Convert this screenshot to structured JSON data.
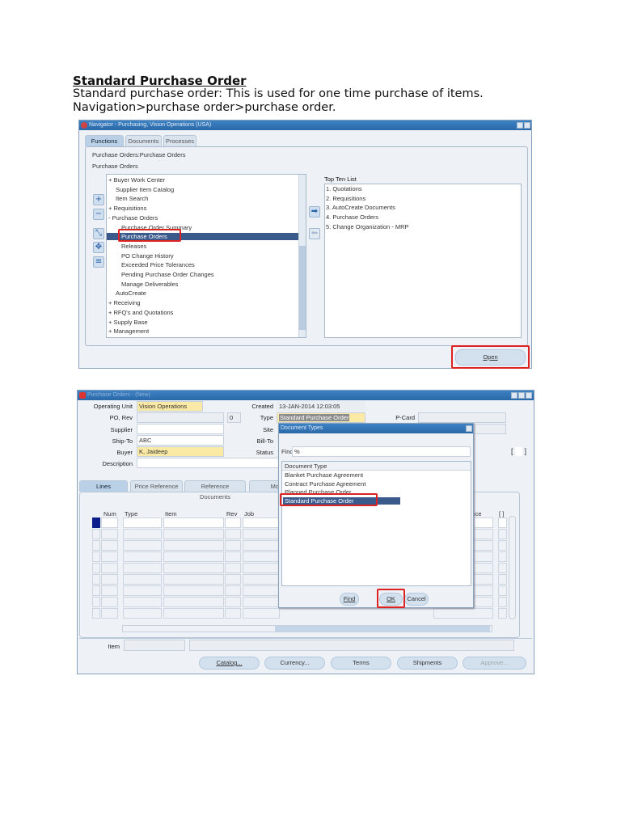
{
  "doc": {
    "heading": "Standard Purchase Order",
    "line1": "Standard purchase order: This is used for one time purchase of items.",
    "line2": "Navigation>purchase order>purchase order."
  },
  "navigator": {
    "title": "Navigator - Purchasing, Vision Operations (USA)",
    "tabs": [
      "Functions",
      "Documents",
      "Processes"
    ],
    "breadcrumb": "Purchase Orders:Purchase Orders",
    "section": "Purchase Orders",
    "items": [
      "+ Buyer Work Center",
      "Supplier Item Catalog",
      "Item Search",
      "+ Requisitions",
      "- Purchase Orders",
      "Purchase Order Summary",
      "Purchase Orders",
      "Releases",
      "PO Change History",
      "Exceeded Price Tolerances",
      "Pending Purchase Order Changes",
      "Manage Deliverables",
      "AutoCreate",
      "+ Receiving",
      "+ RFQ's and Quotations",
      "+ Supply Base",
      "+ Management"
    ],
    "selected_index": 6,
    "top_ten_label": "Top Ten List",
    "top_ten": [
      "1. Quotations",
      "2. Requisitions",
      "3. AutoCreate Documents",
      "4. Purchase Orders",
      "5. Change Organization - MRP"
    ],
    "open_button": "Open"
  },
  "po_form": {
    "title": "Purchase Orders - (New)",
    "labels": {
      "operating_unit": "Operating Unit",
      "po_rev": "PO, Rev",
      "supplier": "Supplier",
      "ship_to": "Ship-To",
      "buyer": "Buyer",
      "description": "Description",
      "created": "Created",
      "type": "Type",
      "site": "Site",
      "bill_to": "Bill-To",
      "status": "Status",
      "pcard": "P-Card",
      "item": "Item"
    },
    "values": {
      "operating_unit": "Vision Operations",
      "rev": "0",
      "ship_to": "ABC",
      "buyer": "K, Jaideep",
      "created": "13-JAN-2014 12:03:05",
      "type": "Standard Purchase Order"
    },
    "tabs": [
      "Lines",
      "Price Reference",
      "Reference Documents",
      "Mo"
    ],
    "columns": [
      "Num",
      "Type",
      "Item",
      "Rev",
      "Job",
      "ice",
      "[ ]"
    ],
    "status_bracket": "[ ]",
    "buttons": [
      "Catalog...",
      "Currency...",
      "Terms",
      "Shipments",
      "Approve..."
    ]
  },
  "doc_types_dialog": {
    "title": "Document Types",
    "find_label": "Find",
    "find_value": "%",
    "column": "Document Type",
    "items": [
      "Blanket Purchase Agreement",
      "Contract Purchase Agreement",
      "Planned Purchase Order",
      "Standard Purchase Order"
    ],
    "selected_index": 3,
    "buttons": {
      "find": "Find",
      "ok": "OK",
      "cancel": "Cancel"
    }
  },
  "colors": {
    "title_bar": "#2a68a8",
    "highlight": "#d22222",
    "selection": "#3a5a8c",
    "required": "#fbe9a6"
  }
}
